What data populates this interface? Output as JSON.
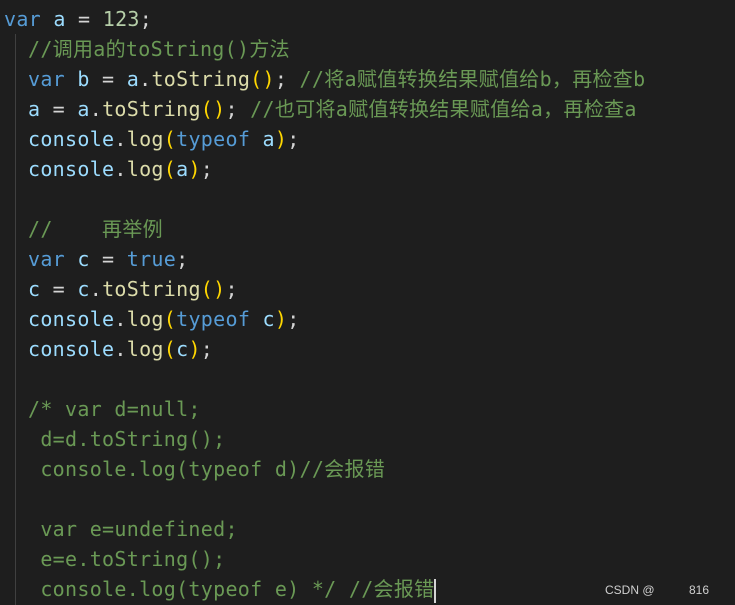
{
  "code": {
    "line1": {
      "kw": "var",
      "name": " a",
      "eq": " = ",
      "num": "123",
      "semi": ";"
    },
    "line2": {
      "comment": "//调用a的toString()方法"
    },
    "line3": {
      "kw": "var",
      "name": " b",
      "eq": " = ",
      "obj": "a",
      "dot": ".",
      "fn": "toString",
      "paren": "()",
      "semi": "; ",
      "comment": "//将a赋值转换结果赋值给b，再检查b"
    },
    "line4": {
      "name": "a",
      "eq": " = ",
      "obj": "a",
      "dot": ".",
      "fn": "toString",
      "paren": "()",
      "semi": "; ",
      "comment": "//也可将a赋值转换结果赋值给a，再检查a"
    },
    "line5": {
      "obj": "console",
      "dot": ".",
      "fn": "log",
      "open": "(",
      "kw": "typeof",
      "arg": " a",
      "close": ")",
      "semi": ";"
    },
    "line6": {
      "obj": "console",
      "dot": ".",
      "fn": "log",
      "open": "(",
      "arg": "a",
      "close": ")",
      "semi": ";"
    },
    "line8": {
      "comment": "//    再举例"
    },
    "line9": {
      "kw": "var",
      "name": " c",
      "eq": " = ",
      "val": "true",
      "semi": ";"
    },
    "line10": {
      "name": "c",
      "eq": " = ",
      "obj": "c",
      "dot": ".",
      "fn": "toString",
      "paren": "()",
      "semi": ";"
    },
    "line11": {
      "obj": "console",
      "dot": ".",
      "fn": "log",
      "open": "(",
      "kw": "typeof",
      "arg": " c",
      "close": ")",
      "semi": ";"
    },
    "line12": {
      "obj": "console",
      "dot": ".",
      "fn": "log",
      "open": "(",
      "arg": "c",
      "close": ")",
      "semi": ";"
    },
    "line14": {
      "comment": "/* var d=null;"
    },
    "line15": {
      "comment": " d=d.toString();"
    },
    "line16": {
      "comment": " console.log(typeof d)//会报错"
    },
    "line18": {
      "comment": " var e=undefined;"
    },
    "line19": {
      "comment": " e=e.toString();"
    },
    "line20": {
      "comment": " console.log(typeof e) */ //会报错"
    }
  },
  "watermark": {
    "text": "CSDN @",
    "number": "816"
  }
}
